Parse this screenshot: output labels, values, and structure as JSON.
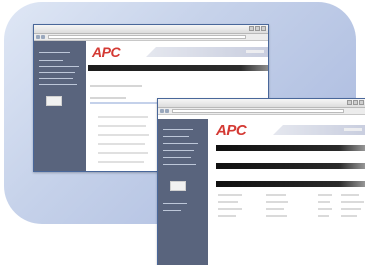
{
  "windows": [
    {
      "name": "browser-window-back",
      "logo": "APC"
    },
    {
      "name": "browser-window-front",
      "logo": "APC"
    }
  ]
}
